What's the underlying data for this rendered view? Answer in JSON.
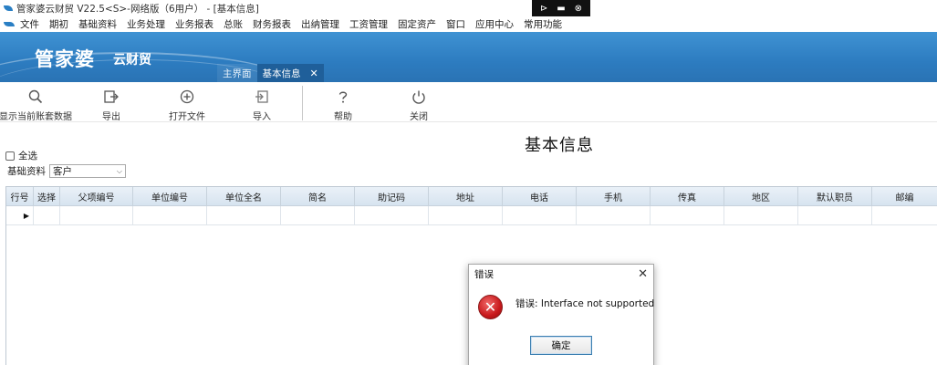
{
  "window": {
    "title": "管家婆云财贸 V22.5<S>-网络版（6用户） - [基本信息]"
  },
  "float_bar": {
    "icons": [
      "pin-icon",
      "window-icon",
      "close-icon"
    ],
    "glyphs": [
      "⊳",
      "▬",
      "⊗"
    ]
  },
  "menu": {
    "items": [
      "文件",
      "期初",
      "基础资料",
      "业务处理",
      "业务报表",
      "总账",
      "财务报表",
      "出纳管理",
      "工资管理",
      "固定资产",
      "窗口",
      "应用中心",
      "常用功能"
    ]
  },
  "banner": {
    "brand": "管家婆",
    "brand_sub": "云财贸",
    "tabs": [
      {
        "label": "主界面"
      },
      {
        "label": "基本信息",
        "close": "✕"
      }
    ]
  },
  "toolbar": {
    "items": [
      {
        "label": "显示当前账套数据",
        "icon": "search-icon",
        "glyph": "⚲"
      },
      {
        "label": "导出",
        "icon": "export-icon",
        "glyph": "⇥"
      },
      {
        "label": "打开文件",
        "icon": "add-circle-icon",
        "glyph": "⊕"
      },
      {
        "label": "导入",
        "icon": "import-icon",
        "glyph": "⇤"
      },
      {
        "label": "帮助",
        "icon": "help-icon",
        "glyph": "?"
      },
      {
        "label": "关闭",
        "icon": "power-icon",
        "glyph": "⏻"
      }
    ]
  },
  "form": {
    "page_title": "基本信息",
    "select_all": "全选",
    "basic_label": "基础资料",
    "basic_value": "客户",
    "caret": "⌵"
  },
  "grid": {
    "columns": [
      "行号",
      "选择",
      "父项编号",
      "单位编号",
      "单位全名",
      "简名",
      "助记码",
      "地址",
      "电话",
      "手机",
      "传真",
      "地区",
      "默认职员",
      "邮编"
    ],
    "row_marker": "▶"
  },
  "dialog": {
    "title": "错误",
    "close": "✕",
    "icon_glyph": "✕",
    "message": "错误: Interface not supported",
    "ok_label": "确定"
  }
}
